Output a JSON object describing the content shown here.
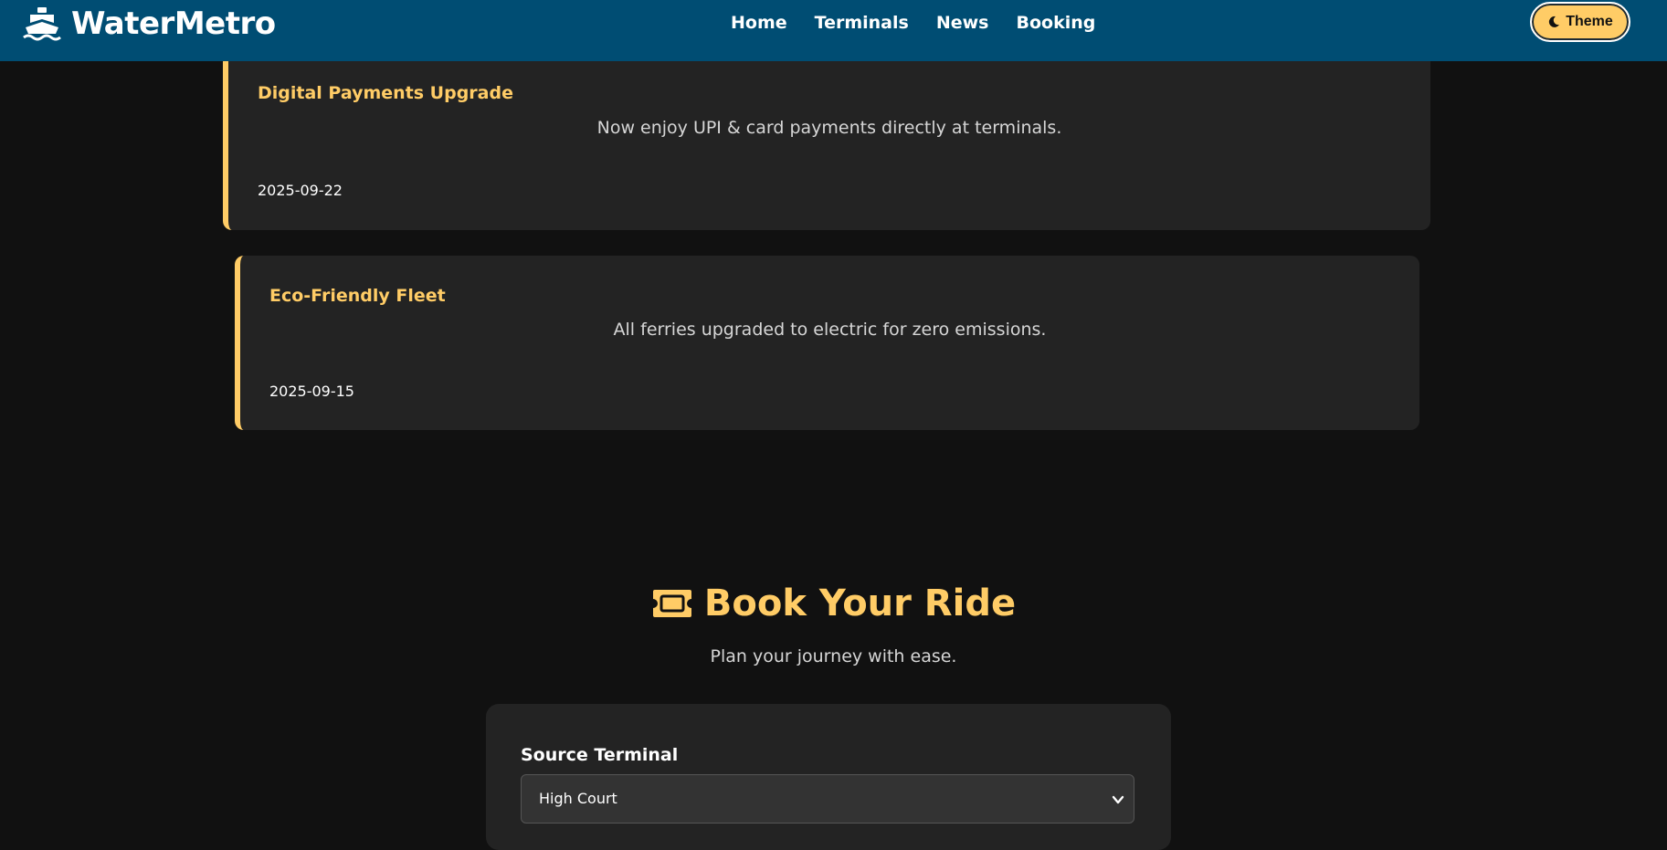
{
  "brand": {
    "name": "WaterMetro",
    "icon": "ship-icon"
  },
  "nav": {
    "links": [
      {
        "label": "Home"
      },
      {
        "label": "Terminals"
      },
      {
        "label": "News"
      },
      {
        "label": "Booking"
      }
    ],
    "theme_button": {
      "label": "Theme",
      "icon": "moon-icon"
    }
  },
  "news": {
    "items": [
      {
        "title": "Digital Payments Upgrade",
        "description": "Now enjoy UPI & card payments directly at terminals.",
        "date": "2025-09-22"
      },
      {
        "title": "Eco-Friendly Fleet",
        "description": "All ferries upgraded to electric for zero emissions.",
        "date": "2025-09-15"
      }
    ]
  },
  "booking": {
    "title": "Book Your Ride",
    "title_icon": "ticket-icon",
    "subtitle": "Plan your journey with ease.",
    "source": {
      "label": "Source Terminal",
      "selected": "High Court"
    }
  },
  "colors": {
    "navbar": "#004d73",
    "accent": "#ffcc66",
    "background": "#111111",
    "card": "#232323"
  }
}
